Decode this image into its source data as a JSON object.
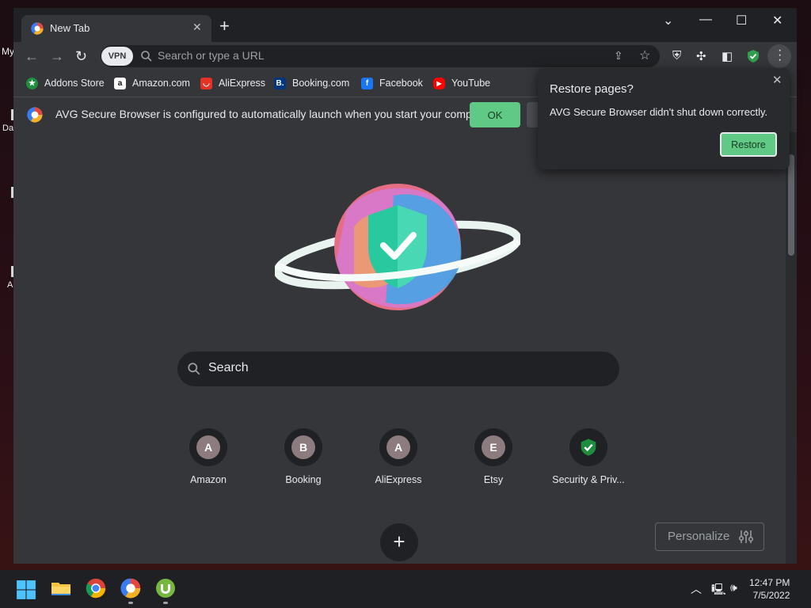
{
  "desktop": {
    "fragments": [
      "My",
      "Da",
      "A"
    ]
  },
  "browser": {
    "tab": {
      "title": "New Tab"
    },
    "window_controls": {
      "dropdown": "⌄",
      "minimize": "—",
      "maximize": "☐",
      "close": "✕"
    },
    "omnibox": {
      "vpn_label": "VPN",
      "placeholder": "Search or type a URL"
    },
    "bookmarks": [
      {
        "label": "Addons Store",
        "color": "#1e8e3e"
      },
      {
        "label": "Amazon.com",
        "color": "#ffffff"
      },
      {
        "label": "AliExpress",
        "color": "#e43225"
      },
      {
        "label": "Booking.com",
        "color": "#003580"
      },
      {
        "label": "Facebook",
        "color": "#1877f2"
      },
      {
        "label": "YouTube",
        "color": "#ff0000"
      }
    ],
    "infobar": {
      "message": "AVG Secure Browser is configured to automatically launch when you start your computer.",
      "ok_label": "OK"
    },
    "restore_popup": {
      "title": "Restore pages?",
      "body": "AVG Secure Browser didn't shut down correctly.",
      "restore_label": "Restore"
    },
    "ntp": {
      "search_placeholder": "Search",
      "shortcuts": [
        {
          "initial": "A",
          "label": "Amazon"
        },
        {
          "initial": "B",
          "label": "Booking"
        },
        {
          "initial": "A",
          "label": "AliExpress"
        },
        {
          "initial": "E",
          "label": "Etsy"
        },
        {
          "initial": "",
          "label": "Security & Priv..."
        }
      ],
      "add_shortcut": "+",
      "personalize_label": "Personalize"
    }
  },
  "taskbar": {
    "time": "12:47 PM",
    "date": "7/5/2022"
  },
  "colors": {
    "accent_green": "#5fc985",
    "window_bg": "#35363a",
    "frame_bg": "#202124"
  }
}
